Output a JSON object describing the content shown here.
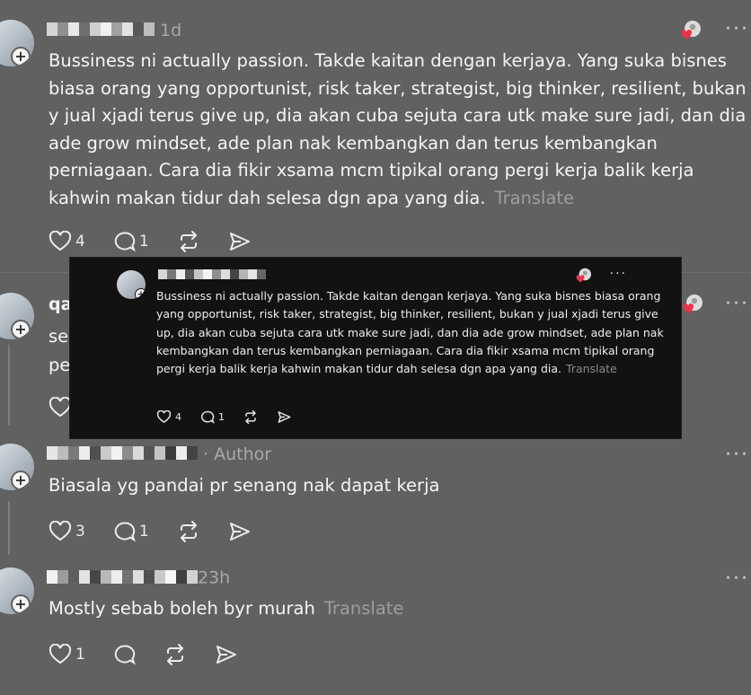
{
  "posts": [
    {
      "meta": "1d",
      "text": "Bussiness ni actually passion. Takde kaitan dengan kerjaya. Yang suka bisnes biasa orang yang opportunist, risk taker, strategist, big thinker, resilient, bukan y jual xjadi terus give up, dia akan cuba sejuta cara utk make sure jadi, dan dia ade grow mindset, ade plan nak kembangkan dan terus kembangkan perniagaan. Cara dia fikir xsama mcm tipikal orang pergi kerja balik kerja kahwin makan tidur dah selesa dgn apa yang dia.",
      "translate": "Translate",
      "likes": "4",
      "replies": "1"
    },
    {
      "username_partial": "qa",
      "text_partial_1": "sel",
      "text_partial_2": "pe"
    },
    {
      "meta": "· Author",
      "text": "Biasala yg pandai pr senang nak dapat kerja",
      "likes": "3",
      "replies": "1"
    },
    {
      "meta": "23h",
      "text": "Mostly sebab boleh byr murah",
      "translate": "Translate",
      "likes": "1",
      "replies": ""
    }
  ],
  "overlay": {
    "text": "Bussiness ni actually passion. Takde kaitan dengan kerjaya. Yang suka bisnes biasa orang yang opportunist, risk taker, strategist, big thinker, resilient, bukan y jual xjadi terus give up, dia akan cuba sejuta cara utk make sure jadi, dan dia ade grow mindset, ade plan nak kembangkan dan terus kembangkan perniagaan. Cara dia fikir xsama mcm tipikal orang pergi kerja balik kerja kahwin makan tidur dah selesa dgn apa yang dia.",
    "translate": "Translate",
    "likes": "4",
    "replies": "1"
  },
  "icons": {
    "like": "heart-icon",
    "reply": "comment-icon",
    "repost": "repost-icon",
    "share": "send-icon",
    "more": "more-icon",
    "add": "plus-icon"
  },
  "colors": {
    "background": "#616161",
    "overlay_background": "#121212",
    "muted_text": "#a9a9a9",
    "reaction_heart": "#e8334a"
  },
  "more_glyph": "···",
  "plus_glyph": "+"
}
